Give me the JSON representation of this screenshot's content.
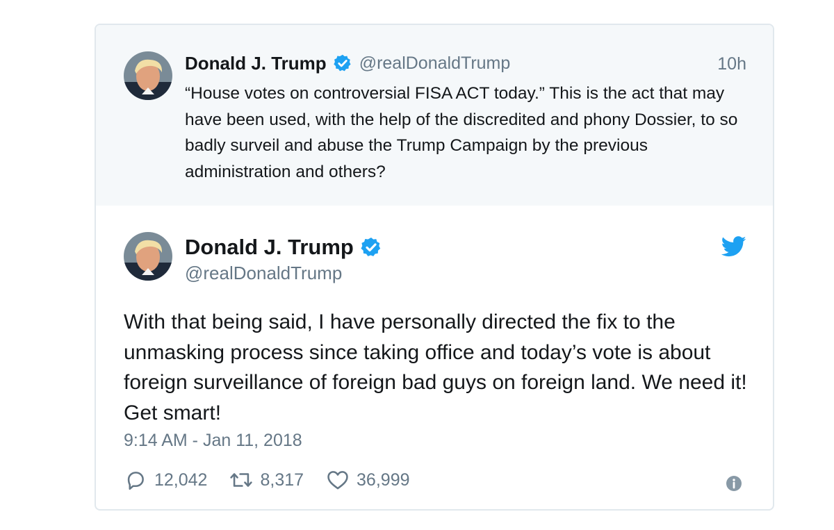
{
  "quoted_tweet": {
    "author_name": "Donald J. Trump",
    "handle": "@realDonaldTrump",
    "time": "10h",
    "text": "“House votes on controversial FISA ACT today.” This is the act that may have been used, with the help of the discredited and phony Dossier, to so badly surveil and abuse the Trump Campaign by the previous administration and others?"
  },
  "tweet": {
    "author_name": "Donald J. Trump",
    "handle": "@realDonaldTrump",
    "text": "With that being said, I have personally directed the fix to the unmasking process since taking office and today’s vote is about foreign surveillance of foreign bad guys on foreign land. We need it! Get smart!",
    "timestamp": "9:14 AM - Jan 11, 2018",
    "replies": "12,042",
    "retweets": "8,317",
    "likes": "36,999"
  },
  "icons": {
    "verified": "verified-badge-icon",
    "brand": "twitter-bird-icon",
    "reply": "reply-icon",
    "retweet": "retweet-icon",
    "like": "heart-icon",
    "info": "info-icon"
  },
  "colors": {
    "accent": "#1da1f2",
    "text": "#14171a",
    "muted": "#657786",
    "quoted_background": "#f5f8fa",
    "border": "#e1e8ed"
  }
}
